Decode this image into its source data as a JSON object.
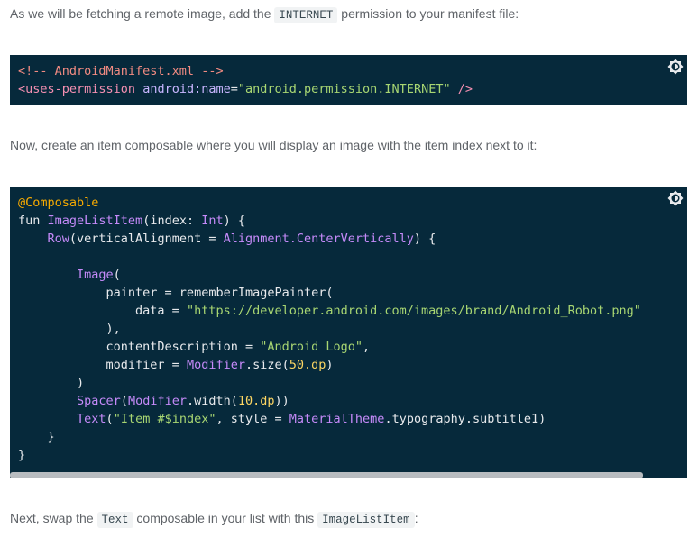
{
  "paragraphs": {
    "p1_before": "As we will be fetching a remote image, add the ",
    "p1_code": "INTERNET",
    "p1_after": " permission to your manifest file:",
    "p2": "Now, create an item composable where you will display an image with the item index next to it:",
    "p3_before": "Next, swap the ",
    "p3_code1": "Text",
    "p3_middle": " composable in your list with this ",
    "p3_code2": "ImageListItem",
    "p3_after": ":"
  },
  "code1": {
    "l1_comment": "<!-- AndroidManifest.xml -->",
    "l2_open": "<uses-permission",
    "l2_attr": "android:name",
    "l2_eq": "=",
    "l2_val": "\"android.permission.INTERNET\"",
    "l2_close": " />"
  },
  "code2": {
    "l1": "@Composable",
    "l2_fun": "fun ",
    "l2_name": "ImageListItem",
    "l2_rest1": "(index: ",
    "l2_type": "Int",
    "l2_rest2": ") {",
    "l3_indent": "    ",
    "l3_row": "Row",
    "l3_mid": "(verticalAlignment = ",
    "l3_align": "Alignment.CenterVertically",
    "l3_end": ") {",
    "l5_indent": "        ",
    "l5_image": "Image",
    "l5_end": "(",
    "l6": "            painter = rememberImagePainter(",
    "l7_pre": "                data = ",
    "l7_str": "\"https://developer.android.com/images/brand/Android_Robot.png\"",
    "l8": "            ),",
    "l9_pre": "            contentDescription = ",
    "l9_str": "\"Android Logo\"",
    "l9_end": ",",
    "l10_pre": "            modifier = ",
    "l10_mod": "Modifier",
    "l10_mid": ".size(",
    "l10_num": "50.dp",
    "l10_end": ")",
    "l11": "        )",
    "l12_indent": "        ",
    "l12_spacer": "Spacer",
    "l12_open": "(",
    "l12_mod": "Modifier",
    "l12_mid": ".width(",
    "l12_num": "10.dp",
    "l12_end": "))",
    "l13_indent": "        ",
    "l13_text": "Text",
    "l13_open": "(",
    "l13_str": "\"Item #$index\"",
    "l13_mid": ", style = ",
    "l13_theme": "MaterialTheme",
    "l13_end": ".typography.subtitle1)",
    "l14": "    }",
    "l15": "}"
  },
  "icons": {
    "theme_toggle": "brightness-icon"
  }
}
